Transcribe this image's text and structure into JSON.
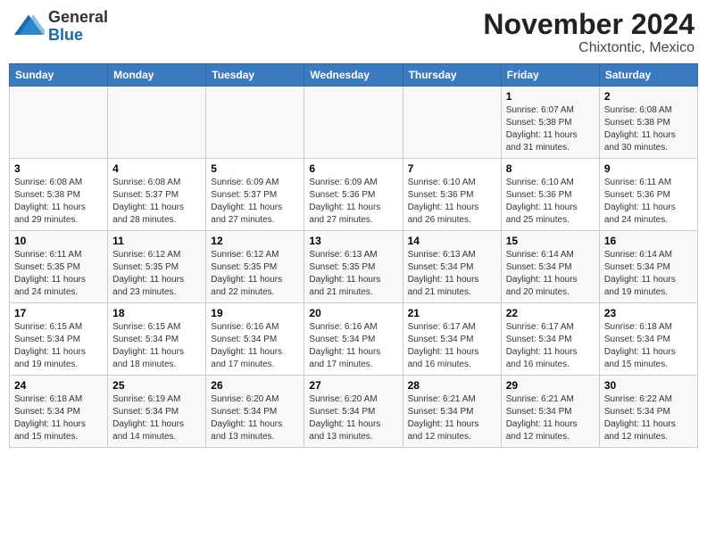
{
  "header": {
    "logo_line1": "General",
    "logo_line2": "Blue",
    "month_title": "November 2024",
    "location": "Chixtontic, Mexico"
  },
  "weekdays": [
    "Sunday",
    "Monday",
    "Tuesday",
    "Wednesday",
    "Thursday",
    "Friday",
    "Saturday"
  ],
  "weeks": [
    [
      {
        "day": "",
        "info": ""
      },
      {
        "day": "",
        "info": ""
      },
      {
        "day": "",
        "info": ""
      },
      {
        "day": "",
        "info": ""
      },
      {
        "day": "",
        "info": ""
      },
      {
        "day": "1",
        "info": "Sunrise: 6:07 AM\nSunset: 5:38 PM\nDaylight: 11 hours and 31 minutes."
      },
      {
        "day": "2",
        "info": "Sunrise: 6:08 AM\nSunset: 5:38 PM\nDaylight: 11 hours and 30 minutes."
      }
    ],
    [
      {
        "day": "3",
        "info": "Sunrise: 6:08 AM\nSunset: 5:38 PM\nDaylight: 11 hours and 29 minutes."
      },
      {
        "day": "4",
        "info": "Sunrise: 6:08 AM\nSunset: 5:37 PM\nDaylight: 11 hours and 28 minutes."
      },
      {
        "day": "5",
        "info": "Sunrise: 6:09 AM\nSunset: 5:37 PM\nDaylight: 11 hours and 27 minutes."
      },
      {
        "day": "6",
        "info": "Sunrise: 6:09 AM\nSunset: 5:36 PM\nDaylight: 11 hours and 27 minutes."
      },
      {
        "day": "7",
        "info": "Sunrise: 6:10 AM\nSunset: 5:36 PM\nDaylight: 11 hours and 26 minutes."
      },
      {
        "day": "8",
        "info": "Sunrise: 6:10 AM\nSunset: 5:36 PM\nDaylight: 11 hours and 25 minutes."
      },
      {
        "day": "9",
        "info": "Sunrise: 6:11 AM\nSunset: 5:36 PM\nDaylight: 11 hours and 24 minutes."
      }
    ],
    [
      {
        "day": "10",
        "info": "Sunrise: 6:11 AM\nSunset: 5:35 PM\nDaylight: 11 hours and 24 minutes."
      },
      {
        "day": "11",
        "info": "Sunrise: 6:12 AM\nSunset: 5:35 PM\nDaylight: 11 hours and 23 minutes."
      },
      {
        "day": "12",
        "info": "Sunrise: 6:12 AM\nSunset: 5:35 PM\nDaylight: 11 hours and 22 minutes."
      },
      {
        "day": "13",
        "info": "Sunrise: 6:13 AM\nSunset: 5:35 PM\nDaylight: 11 hours and 21 minutes."
      },
      {
        "day": "14",
        "info": "Sunrise: 6:13 AM\nSunset: 5:34 PM\nDaylight: 11 hours and 21 minutes."
      },
      {
        "day": "15",
        "info": "Sunrise: 6:14 AM\nSunset: 5:34 PM\nDaylight: 11 hours and 20 minutes."
      },
      {
        "day": "16",
        "info": "Sunrise: 6:14 AM\nSunset: 5:34 PM\nDaylight: 11 hours and 19 minutes."
      }
    ],
    [
      {
        "day": "17",
        "info": "Sunrise: 6:15 AM\nSunset: 5:34 PM\nDaylight: 11 hours and 19 minutes."
      },
      {
        "day": "18",
        "info": "Sunrise: 6:15 AM\nSunset: 5:34 PM\nDaylight: 11 hours and 18 minutes."
      },
      {
        "day": "19",
        "info": "Sunrise: 6:16 AM\nSunset: 5:34 PM\nDaylight: 11 hours and 17 minutes."
      },
      {
        "day": "20",
        "info": "Sunrise: 6:16 AM\nSunset: 5:34 PM\nDaylight: 11 hours and 17 minutes."
      },
      {
        "day": "21",
        "info": "Sunrise: 6:17 AM\nSunset: 5:34 PM\nDaylight: 11 hours and 16 minutes."
      },
      {
        "day": "22",
        "info": "Sunrise: 6:17 AM\nSunset: 5:34 PM\nDaylight: 11 hours and 16 minutes."
      },
      {
        "day": "23",
        "info": "Sunrise: 6:18 AM\nSunset: 5:34 PM\nDaylight: 11 hours and 15 minutes."
      }
    ],
    [
      {
        "day": "24",
        "info": "Sunrise: 6:18 AM\nSunset: 5:34 PM\nDaylight: 11 hours and 15 minutes."
      },
      {
        "day": "25",
        "info": "Sunrise: 6:19 AM\nSunset: 5:34 PM\nDaylight: 11 hours and 14 minutes."
      },
      {
        "day": "26",
        "info": "Sunrise: 6:20 AM\nSunset: 5:34 PM\nDaylight: 11 hours and 13 minutes."
      },
      {
        "day": "27",
        "info": "Sunrise: 6:20 AM\nSunset: 5:34 PM\nDaylight: 11 hours and 13 minutes."
      },
      {
        "day": "28",
        "info": "Sunrise: 6:21 AM\nSunset: 5:34 PM\nDaylight: 11 hours and 12 minutes."
      },
      {
        "day": "29",
        "info": "Sunrise: 6:21 AM\nSunset: 5:34 PM\nDaylight: 11 hours and 12 minutes."
      },
      {
        "day": "30",
        "info": "Sunrise: 6:22 AM\nSunset: 5:34 PM\nDaylight: 11 hours and 12 minutes."
      }
    ]
  ]
}
